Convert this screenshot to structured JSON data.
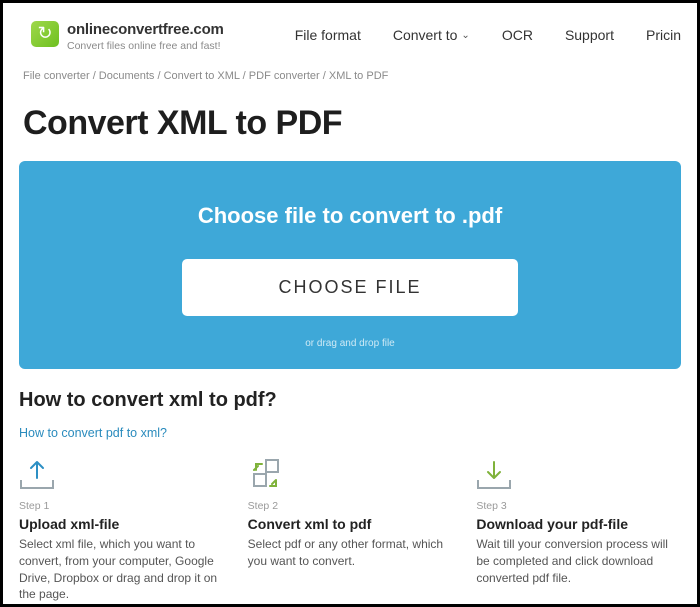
{
  "brand": {
    "name": "onlineconvertfree.com",
    "tagline": "Convert files online free and fast!"
  },
  "nav": {
    "file_format": "File format",
    "convert_to": "Convert to",
    "ocr": "OCR",
    "support": "Support",
    "pricing": "Pricin"
  },
  "breadcrumb": "File converter / Documents / Convert to XML / PDF converter / XML to PDF",
  "page_title": "Convert XML to PDF",
  "hero": {
    "heading": "Choose file to convert to .pdf",
    "button": "CHOOSE FILE",
    "sub": "or drag and drop file"
  },
  "howto": {
    "title": "How to convert xml to pdf?",
    "reverse_link": "How to convert pdf to xml?",
    "steps": [
      {
        "label": "Step 1",
        "title": "Upload xml-file",
        "desc": "Select xml file, which you want to convert, from your computer, Google Drive, Dropbox or drag and drop it on the page."
      },
      {
        "label": "Step 2",
        "title": "Convert xml to pdf",
        "desc": "Select pdf or any other format, which you want to convert."
      },
      {
        "label": "Step 3",
        "title": "Download your pdf-file",
        "desc": "Wait till your conversion process will be completed and click download converted pdf file."
      }
    ]
  }
}
